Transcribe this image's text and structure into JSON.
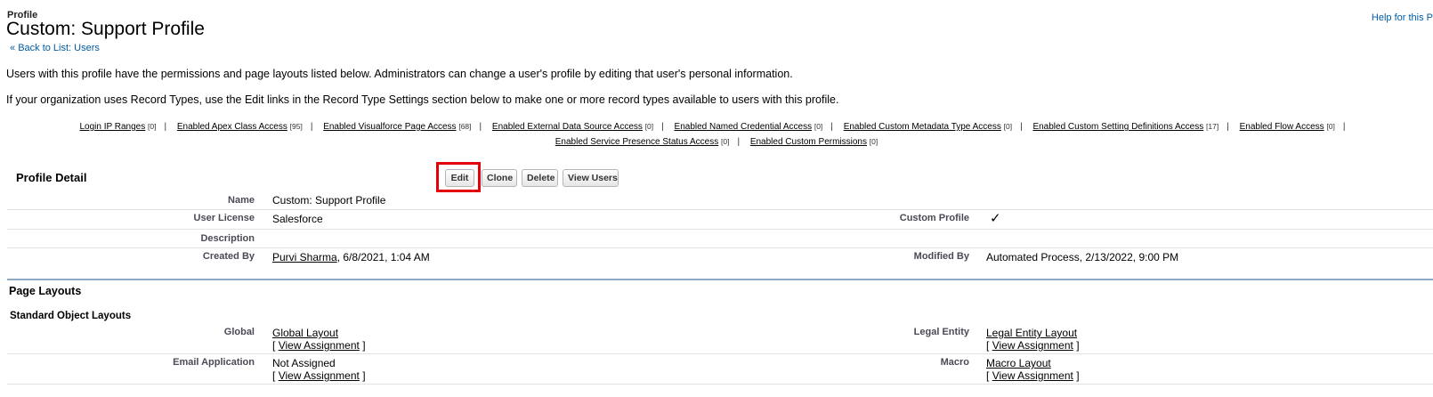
{
  "header": {
    "page_type": "Profile",
    "title": "Custom: Support Profile",
    "help_link": "Help for this P",
    "back_prefix": "«",
    "back_link": "Back to List: Users"
  },
  "intro": {
    "line1": "Users with this profile have the permissions and page layouts listed below. Administrators can change a user's profile by editing that user's personal information.",
    "line2": "If your organization uses Record Types, use the Edit links in the Record Type Settings section below to make one or more record types available to users with this profile."
  },
  "related_links": {
    "row1": [
      {
        "label": "Login IP Ranges",
        "count": "[0]"
      },
      {
        "label": "Enabled Apex Class Access",
        "count": "[95]"
      },
      {
        "label": "Enabled Visualforce Page Access",
        "count": "[68]"
      },
      {
        "label": "Enabled External Data Source Access",
        "count": "[0]"
      },
      {
        "label": "Enabled Named Credential Access",
        "count": "[0]"
      },
      {
        "label": "Enabled Custom Metadata Type Access",
        "count": "[0]"
      },
      {
        "label": "Enabled Custom Setting Definitions Access",
        "count": "[17]"
      },
      {
        "label": "Enabled Flow Access",
        "count": "[0]"
      }
    ],
    "row2": [
      {
        "label": "Enabled Service Presence Status Access",
        "count": "[0]"
      },
      {
        "label": "Enabled Custom Permissions",
        "count": "[0]"
      }
    ],
    "separator": "|"
  },
  "profile_detail": {
    "title": "Profile Detail",
    "buttons": {
      "edit": "Edit",
      "clone": "Clone",
      "delete": "Delete",
      "view_users": "View Users"
    },
    "fields": {
      "name_label": "Name",
      "name_value": "Custom: Support Profile",
      "user_license_label": "User License",
      "user_license_value": "Salesforce",
      "custom_profile_label": "Custom Profile",
      "custom_profile_value": "✓",
      "description_label": "Description",
      "created_by_label": "Created By",
      "created_by_user": "Purvi Sharma",
      "created_by_date": ", 6/8/2021, 1:04 AM",
      "modified_by_label": "Modified By",
      "modified_by_value": "Automated Process, 2/13/2022, 9:00 PM"
    }
  },
  "page_layouts": {
    "title": "Page Layouts",
    "subtitle": "Standard Object Layouts",
    "view_assignment": "View Assignment",
    "bracket_open": "[",
    "bracket_close": "]",
    "rows": [
      {
        "label": "Global",
        "value": "Global Layout",
        "right_label": "Legal Entity",
        "right_value": "Legal Entity Layout"
      },
      {
        "label": "Email Application",
        "value": "Not Assigned",
        "right_label": "Macro",
        "right_value": "Macro Layout"
      }
    ]
  }
}
